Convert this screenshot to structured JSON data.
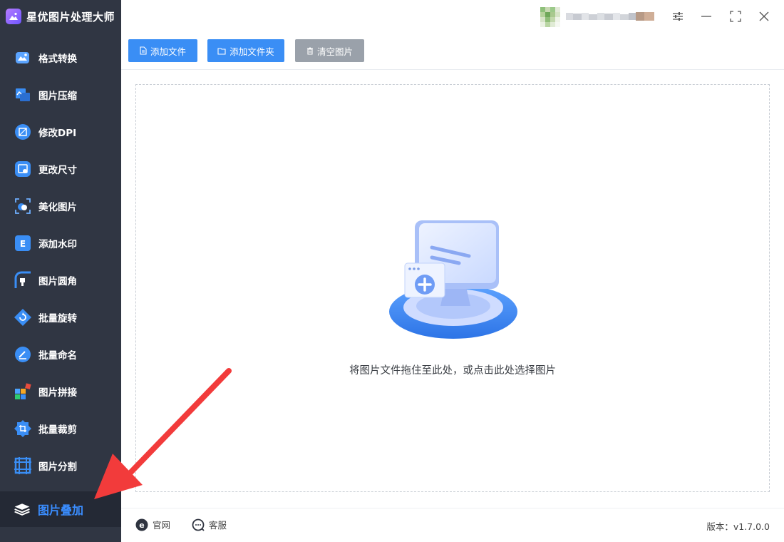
{
  "app": {
    "title": "星优图片处理大师"
  },
  "sidebar": {
    "items": [
      {
        "label": "格式转换",
        "icon": "format-convert-icon"
      },
      {
        "label": "图片压缩",
        "icon": "compress-icon"
      },
      {
        "label": "修改DPI",
        "icon": "dpi-icon"
      },
      {
        "label": "更改尺寸",
        "icon": "resize-icon"
      },
      {
        "label": "美化图片",
        "icon": "beautify-icon"
      },
      {
        "label": "添加水印",
        "icon": "watermark-icon"
      },
      {
        "label": "图片圆角",
        "icon": "round-corner-icon"
      },
      {
        "label": "批量旋转",
        "icon": "rotate-icon"
      },
      {
        "label": "批量命名",
        "icon": "rename-icon"
      },
      {
        "label": "图片拼接",
        "icon": "stitch-icon"
      },
      {
        "label": "批量裁剪",
        "icon": "crop-icon"
      },
      {
        "label": "图片分割",
        "icon": "split-icon"
      }
    ],
    "active": {
      "label": "图片叠加",
      "icon": "layers-icon"
    }
  },
  "toolbar": {
    "add_file": "添加文件",
    "add_folder": "添加文件夹",
    "clear": "清空图片"
  },
  "dropzone": {
    "text": "将图片文件拖住至此处，或点击此处选择图片"
  },
  "footer": {
    "website": "官网",
    "support": "客服",
    "version": "版本：v1.7.0.0"
  },
  "colors": {
    "accent": "#3a8ef5",
    "sidebar_bg": "#303643",
    "active_text": "#3a8dff"
  }
}
